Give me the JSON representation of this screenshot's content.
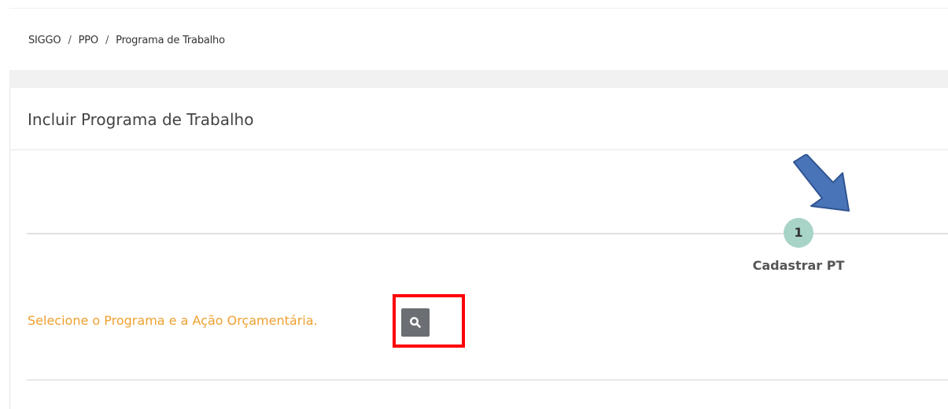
{
  "breadcrumb": {
    "items": [
      "SIGGO",
      "PPO",
      "Programa de Trabalho"
    ],
    "separator": "/"
  },
  "card": {
    "title": "Incluir Programa de Trabalho"
  },
  "wizard": {
    "steps": [
      {
        "number": "1",
        "label": "Cadastrar PT",
        "color": "#a8d4c8"
      }
    ]
  },
  "form": {
    "select_prompt": "Selecione o Programa e a Ação Orçamentária.",
    "select_prompt_color": "#f0a030",
    "search_button_icon": "search-icon"
  },
  "annotations": {
    "arrow_color": "#4a74b8",
    "highlight_color": "#ff0000"
  }
}
